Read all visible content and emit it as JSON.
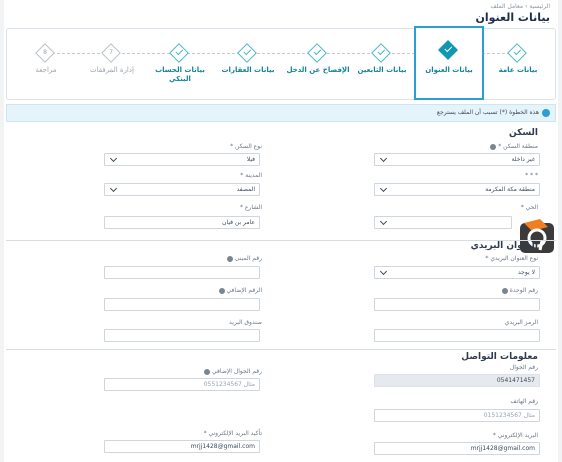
{
  "breadcrumb": "الرئيسية › معامل الملف",
  "page_title": "بيانات العنوان",
  "steps": [
    {
      "label": "بيانات عامة",
      "state": "done",
      "icon": "check-icon"
    },
    {
      "label": "بيانات العنوان",
      "state": "active",
      "icon": "check-icon"
    },
    {
      "label": "بيانات التابعين",
      "state": "done",
      "icon": "check-icon"
    },
    {
      "label": "الإفصاح عن الدخل",
      "state": "done",
      "icon": "check-icon"
    },
    {
      "label": "بيانات العقارات",
      "state": "done",
      "icon": "check-icon"
    },
    {
      "label": "بيانات الحساب البنكي",
      "state": "done",
      "icon": "check-icon"
    },
    {
      "label": "إدارة المرفقات",
      "state": "pending",
      "number": "7"
    },
    {
      "label": "مراجعة",
      "state": "pending",
      "number": "8"
    }
  ],
  "notice": "هذه الخطوة (*) تسبب أن الملف يسترجع",
  "housing": {
    "title": "السكن",
    "region_label": "منطقة السكن *",
    "region_value": "غير داخلة",
    "housing_type_label": "نوع السكن *",
    "housing_type_value": "فيلا",
    "area_label": "* * *",
    "area_value": "منطقة مكة المكرمة",
    "city_label": "المدينة *",
    "city_value": "المصفد",
    "district_label": "الحي *",
    "district_value": "",
    "street_label": "الشارع *",
    "street_value": "عامر بن فيان"
  },
  "postal": {
    "title": "العنوان البريدي",
    "type_label": "نوع العنوان البريدي *",
    "type_value": "لا يوجد",
    "building_label": "رقم المبنى",
    "building_value": "",
    "unit_label": "رقم الوحدة",
    "unit_value": "",
    "additional_label": "الرقم الإضافي",
    "additional_value": "",
    "postal_code_label": "الرمز البريدي",
    "postal_code_value": "",
    "po_box_label": "صندوق البريد",
    "po_box_value": ""
  },
  "contact": {
    "title": "معلومات التواصل",
    "mobile_label": "رقم الجوال",
    "mobile_value": "0541471457",
    "alt_mobile_label": "رقم الجوال الإضافي",
    "alt_mobile_placeholder": "مثال 0551234567",
    "phone_label": "رقم الهاتف",
    "phone_placeholder": "مثال 0151234567",
    "email_label": "البريد الإلكتروني *",
    "email_value": "mrjj1428@gmail.com",
    "email_confirm_label": "تأكيد البريد الإلكتروني *",
    "email_confirm_value": "mrjj1428@gmail.com"
  },
  "colors": {
    "accent": "#0f97b3",
    "active_border": "#2a9fd6",
    "notice_bg": "#e5f3fa"
  }
}
